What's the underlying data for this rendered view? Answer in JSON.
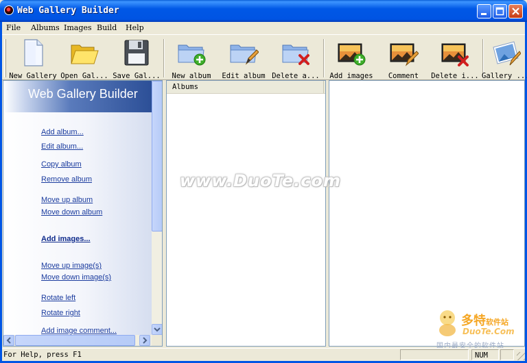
{
  "window": {
    "title": "Web Gallery Builder"
  },
  "menu": [
    {
      "label": "File"
    },
    {
      "label": "Albums"
    },
    {
      "label": "Images"
    },
    {
      "label": "Build"
    },
    {
      "label": "Help"
    }
  ],
  "toolbar": {
    "new_gallery": "New Gallery",
    "open_gallery": "Open Gal...",
    "save_gallery": "Save Gal...",
    "new_album": "New album",
    "edit_album": "Edit album",
    "delete_album": "Delete a...",
    "add_images": "Add images",
    "comment": "Comment",
    "delete_image": "Delete i...",
    "gallery": "Gallery ..."
  },
  "taskpane": {
    "title": "Web Gallery Builder",
    "links": [
      "Add album...",
      "Edit album...",
      "Copy album",
      "Remove album",
      "Move up album",
      "Move down album",
      "Add images...",
      "Move up image(s)",
      "Move down image(s)",
      "Rotate left",
      "Rotate right",
      "Add image comment..."
    ]
  },
  "albums_pane": {
    "column_header": "Albums"
  },
  "watermark": {
    "center_text": "www.DuoTe.com",
    "logo_cn": "多特",
    "logo_cn_small": "软件站",
    "logo_en": "DuoTe.Com",
    "logo_sub": "国内最安全的软件站"
  },
  "statusbar": {
    "help_text": "For Help, press F1",
    "num_indicator": "NUM"
  },
  "colors": {
    "titlebar": "#0054e3",
    "link": "#1a3b9e",
    "pane_border": "#7f9db9",
    "face": "#ece9d8"
  }
}
